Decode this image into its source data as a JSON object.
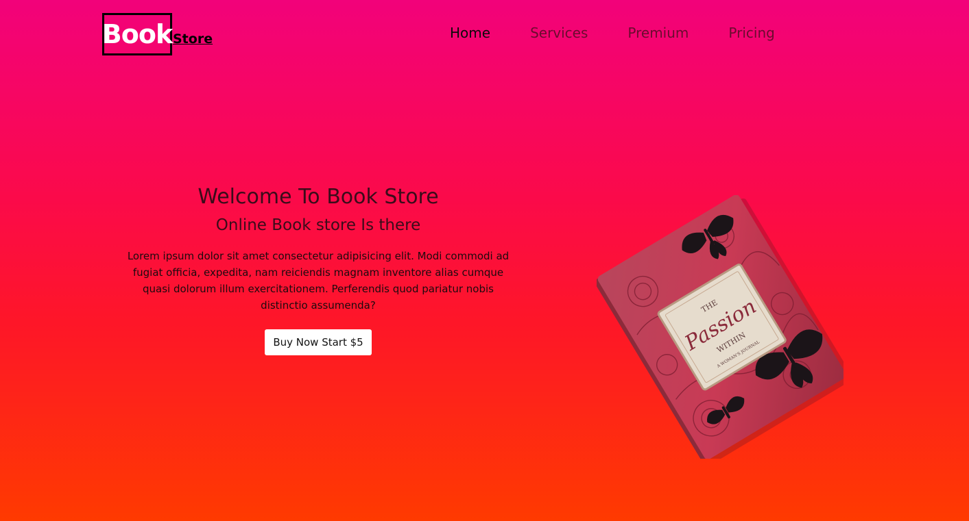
{
  "logo": {
    "main": "Book",
    "sub": "Store"
  },
  "nav": {
    "items": [
      {
        "label": "Home",
        "active": true
      },
      {
        "label": "Services",
        "active": false
      },
      {
        "label": "Premium",
        "active": false
      },
      {
        "label": "Pricing",
        "active": false
      }
    ]
  },
  "hero": {
    "title": "Welcome To Book Store",
    "subtitle": "Online Book store Is there",
    "description": "Lorem ipsum dolor sit amet consectetur adipisicing elit. Modi commodi ad fugiat officia, expedita, nam reiciendis magnam inventore alias cumque quasi dolorum illum exercitationem. Perferendis quod pariatur nobis distinctio assumenda?",
    "button_label": "Buy Now Start $5"
  },
  "book_image": {
    "label_line1": "THE",
    "label_line2": "Passion",
    "label_line3": "WITHIN",
    "label_line4": "A WOMAN'S JOURNAL"
  },
  "colors": {
    "gradient_top": "#f2027a",
    "gradient_bottom": "#ff3a00",
    "book_cover": "#c93a55"
  }
}
